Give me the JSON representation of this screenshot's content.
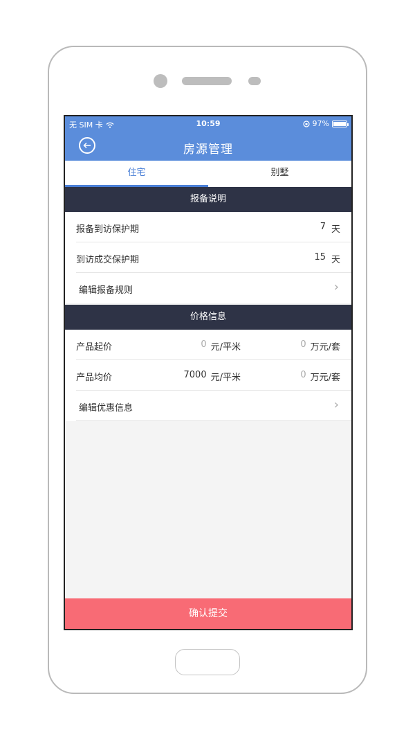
{
  "status_bar": {
    "carrier": "无 SIM 卡",
    "time": "10:59",
    "battery": "97%",
    "battery_level": 0.97
  },
  "header": {
    "title": "房源管理"
  },
  "tabs": [
    {
      "label": "住宅",
      "active": true
    },
    {
      "label": "别墅",
      "active": false
    }
  ],
  "section_report": {
    "title": "报备说明",
    "rows": [
      {
        "label": "报备到访保护期",
        "value": "7",
        "unit": "天"
      },
      {
        "label": "到访成交保护期",
        "value": "15",
        "unit": "天"
      }
    ],
    "edit_label": "编辑报备规则"
  },
  "section_price": {
    "title": "价格信息",
    "rows": [
      {
        "label": "产品起价",
        "unit_price": "0",
        "unit_price_unit": "元/平米",
        "total_price": "0",
        "total_price_unit": "万元/套"
      },
      {
        "label": "产品均价",
        "unit_price": "7000",
        "unit_price_unit": "元/平米",
        "total_price": "0",
        "total_price_unit": "万元/套"
      }
    ],
    "edit_label": "编辑优惠信息"
  },
  "submit_label": "确认提交",
  "colors": {
    "header": "#5b8ddb",
    "section_header": "#2e3346",
    "submit": "#f86b75",
    "tab_active": "#4a7fd6"
  }
}
